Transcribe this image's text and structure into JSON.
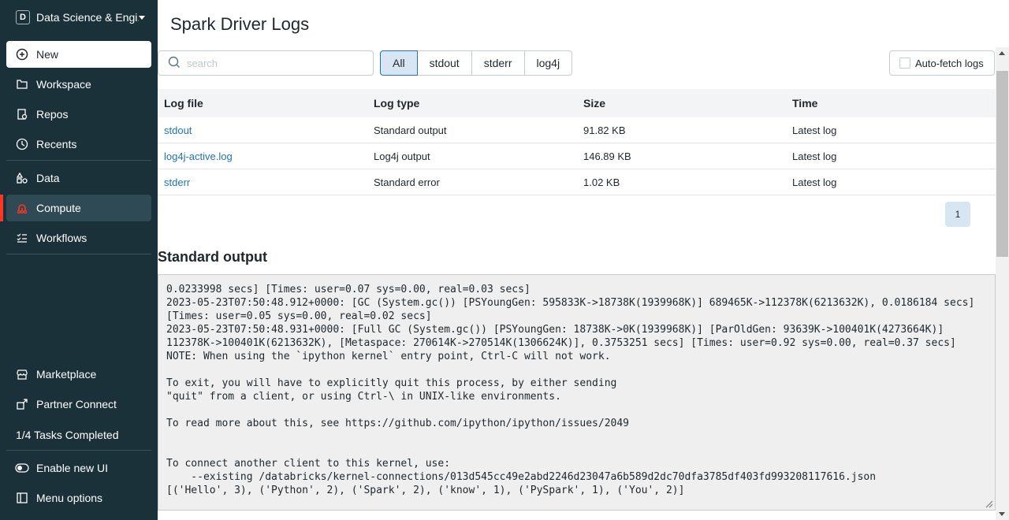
{
  "sidebar": {
    "workspace_badge": "D",
    "workspace_name": "Data Science & Engi...",
    "new_label": "New",
    "items": [
      {
        "label": "Workspace"
      },
      {
        "label": "Repos"
      },
      {
        "label": "Recents"
      },
      {
        "label": "Data"
      },
      {
        "label": "Compute"
      },
      {
        "label": "Workflows"
      }
    ],
    "bottom_items": [
      {
        "label": "Marketplace"
      },
      {
        "label": "Partner Connect"
      }
    ],
    "tasks_label": "1/4 Tasks Completed",
    "enable_ui_label": "Enable new UI",
    "menu_options_label": "Menu options",
    "active_item": "Compute",
    "colors": {
      "background": "#1b3139",
      "active_indicator": "#ff3621"
    }
  },
  "page": {
    "title": "Spark Driver Logs"
  },
  "filters": {
    "search_placeholder": "search",
    "search_value": "",
    "tabs": [
      {
        "label": "All",
        "selected": true
      },
      {
        "label": "stdout",
        "selected": false
      },
      {
        "label": "stderr",
        "selected": false
      },
      {
        "label": "log4j",
        "selected": false
      }
    ],
    "auto_fetch_label": "Auto-fetch logs",
    "auto_fetch_checked": false
  },
  "table": {
    "headers": [
      "Log file",
      "Log type",
      "Size",
      "Time"
    ],
    "rows": [
      {
        "file": "stdout",
        "type": "Standard output",
        "size": "91.82 KB",
        "time": "Latest log"
      },
      {
        "file": "log4j-active.log",
        "type": "Log4j output",
        "size": "146.89 KB",
        "time": "Latest log"
      },
      {
        "file": "stderr",
        "type": "Standard error",
        "size": "1.02 KB",
        "time": "Latest log"
      }
    ],
    "current_page": "1"
  },
  "output": {
    "title": "Standard output",
    "lines": [
      "",
      "0.0233998 secs] [Times: user=0.07 sys=0.00, real=0.03 secs]",
      "2023-05-23T07:50:48.912+0000: [GC (System.gc()) [PSYoungGen: 595833K->18738K(1939968K)] 689465K->112378K(6213632K), 0.0186184 secs]",
      "[Times: user=0.05 sys=0.00, real=0.02 secs]",
      "2023-05-23T07:50:48.931+0000: [Full GC (System.gc()) [PSYoungGen: 18738K->0K(1939968K)] [ParOldGen: 93639K->100401K(4273664K)]",
      "112378K->100401K(6213632K), [Metaspace: 270614K->270514K(1306624K)], 0.3753251 secs] [Times: user=0.92 sys=0.00, real=0.37 secs]",
      "NOTE: When using the `ipython kernel` entry point, Ctrl-C will not work.",
      "",
      "To exit, you will have to explicitly quit this process, by either sending",
      "\"quit\" from a client, or using Ctrl-\\ in UNIX-like environments.",
      "",
      "To read more about this, see https://github.com/ipython/ipython/issues/2049",
      "",
      "",
      "To connect another client to this kernel, use:",
      "    --existing /databricks/kernel-connections/013d545cc49e2abd2246d23047a6b589d2dc70dfa3785df403fd993208117616.json",
      "[('Hello', 3), ('Python', 2), ('Spark', 2), ('know', 1), ('PySpark', 1), ('You', 2)]"
    ]
  }
}
